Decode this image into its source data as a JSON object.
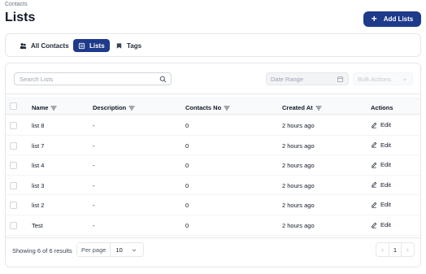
{
  "breadcrumb": "Contacts",
  "page_title": "Lists",
  "add_button": "Add Lists",
  "tabs": [
    {
      "label": "All Contacts",
      "icon": "contacts-icon",
      "active": false
    },
    {
      "label": "Lists",
      "icon": "list-icon",
      "active": true
    },
    {
      "label": "Tags",
      "icon": "tag-icon",
      "active": false
    }
  ],
  "filters": {
    "search_placeholder": "Search Lists",
    "date_range_placeholder": "Date Range",
    "bulk_actions": "Bulk Actions"
  },
  "columns": [
    "Name",
    "Description",
    "Contacts No",
    "Created At",
    "Actions"
  ],
  "rows": [
    {
      "name": "list 8",
      "description": "-",
      "contacts_no": "0",
      "created_at": "2 hours ago",
      "action": "Edit"
    },
    {
      "name": "list 7",
      "description": "-",
      "contacts_no": "0",
      "created_at": "2 hours ago",
      "action": "Edit"
    },
    {
      "name": "list 4",
      "description": "-",
      "contacts_no": "0",
      "created_at": "2 hours ago",
      "action": "Edit"
    },
    {
      "name": "list 3",
      "description": "-",
      "contacts_no": "0",
      "created_at": "2 hours ago",
      "action": "Edit"
    },
    {
      "name": "list 2",
      "description": "-",
      "contacts_no": "0",
      "created_at": "2 hours ago",
      "action": "Edit"
    },
    {
      "name": "Test",
      "description": "-",
      "contacts_no": "0",
      "created_at": "2 hours ago",
      "action": "Edit"
    }
  ],
  "footer": {
    "showing": "Showing 6 of 6 results",
    "per_page_label": "Per page",
    "per_page_value": "10",
    "current_page": "1"
  },
  "colors": {
    "accent": "#1e3a8a"
  }
}
